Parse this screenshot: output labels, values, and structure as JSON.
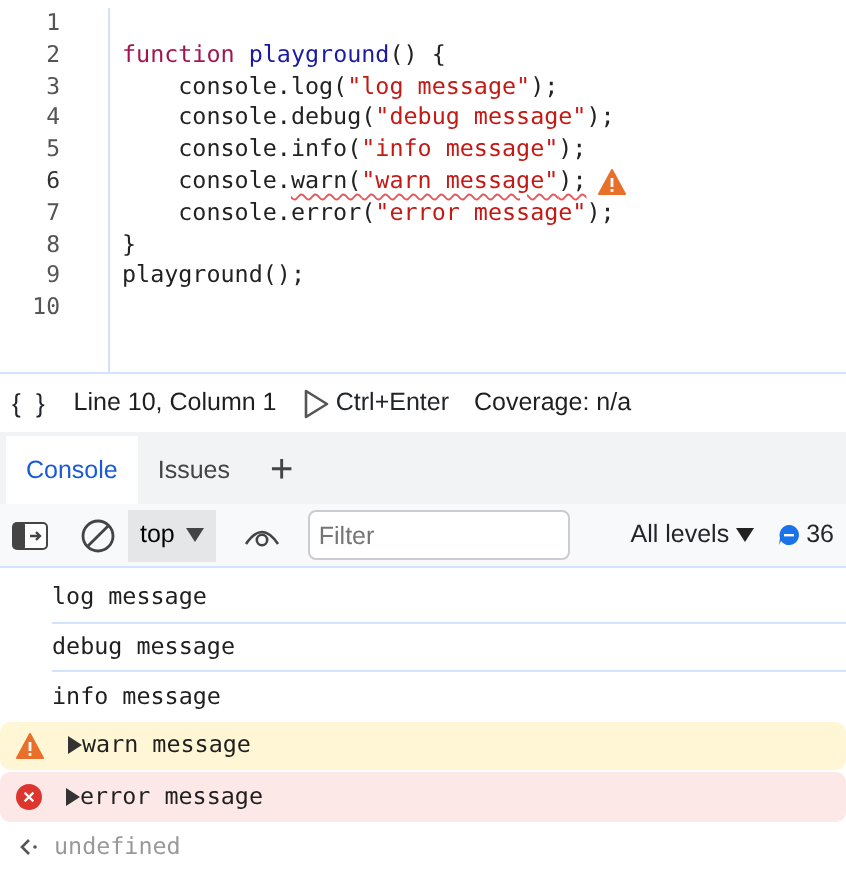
{
  "editor": {
    "lines": [
      {
        "number": "1",
        "warning": false
      },
      {
        "number": "2",
        "warning": false,
        "tokens": [
          {
            "text": "function ",
            "kind": "keyword"
          },
          {
            "text": "playground",
            "kind": "def"
          },
          {
            "text": "() {",
            "kind": "plain"
          }
        ]
      },
      {
        "number": "3",
        "warning": false,
        "tokens": [
          {
            "text": "    console.log(",
            "kind": "plain"
          },
          {
            "text": "\"log message\"",
            "kind": "string"
          },
          {
            "text": ");",
            "kind": "plain"
          }
        ]
      },
      {
        "number": "4",
        "warning": false,
        "tokens": [
          {
            "text": "    console.debug(",
            "kind": "plain"
          },
          {
            "text": "\"debug message\"",
            "kind": "string"
          },
          {
            "text": ");",
            "kind": "plain"
          }
        ]
      },
      {
        "number": "5",
        "warning": false,
        "tokens": [
          {
            "text": "    console.info(",
            "kind": "plain"
          },
          {
            "text": "\"info message\"",
            "kind": "string"
          },
          {
            "text": ");",
            "kind": "plain"
          }
        ]
      },
      {
        "number": "6",
        "warning": true,
        "tokens": [
          {
            "text": "    console.",
            "kind": "plain"
          },
          {
            "text": "warn(",
            "kind": "plain",
            "squiggle": true
          },
          {
            "text": "\"warn message\"",
            "kind": "string",
            "squiggle": true
          },
          {
            "text": ");",
            "kind": "plain",
            "squiggle": true
          }
        ]
      },
      {
        "number": "7",
        "warning": false,
        "tokens": [
          {
            "text": "    console.error(",
            "kind": "plain"
          },
          {
            "text": "\"error message\"",
            "kind": "string"
          },
          {
            "text": ");",
            "kind": "plain"
          }
        ]
      },
      {
        "number": "8",
        "warning": false,
        "tokens": [
          {
            "text": "}",
            "kind": "plain"
          }
        ]
      },
      {
        "number": "9",
        "warning": false,
        "tokens": [
          {
            "text": "playground();",
            "kind": "plain"
          }
        ]
      },
      {
        "number": "10",
        "warning": false
      }
    ]
  },
  "status_bar": {
    "format_button": "{ }",
    "position": "Line 10, Column 1",
    "run_shortcut": "Ctrl+Enter",
    "coverage": "Coverage: n/a"
  },
  "tabs": [
    {
      "label": "Console",
      "selected": true
    },
    {
      "label": "Issues",
      "selected": false
    }
  ],
  "add_tab": "+",
  "toolbar": {
    "context": "top",
    "filter": {
      "placeholder": "Filter"
    },
    "levels": "All levels",
    "message_count": "36"
  },
  "messages": [
    {
      "kind": "log",
      "text": "log message"
    },
    {
      "kind": "debug",
      "text": "debug message"
    },
    {
      "kind": "info",
      "text": "info message"
    },
    {
      "kind": "warn",
      "text": "warn message"
    },
    {
      "kind": "error",
      "text": "error message"
    },
    {
      "kind": "result",
      "text": "undefined"
    }
  ]
}
